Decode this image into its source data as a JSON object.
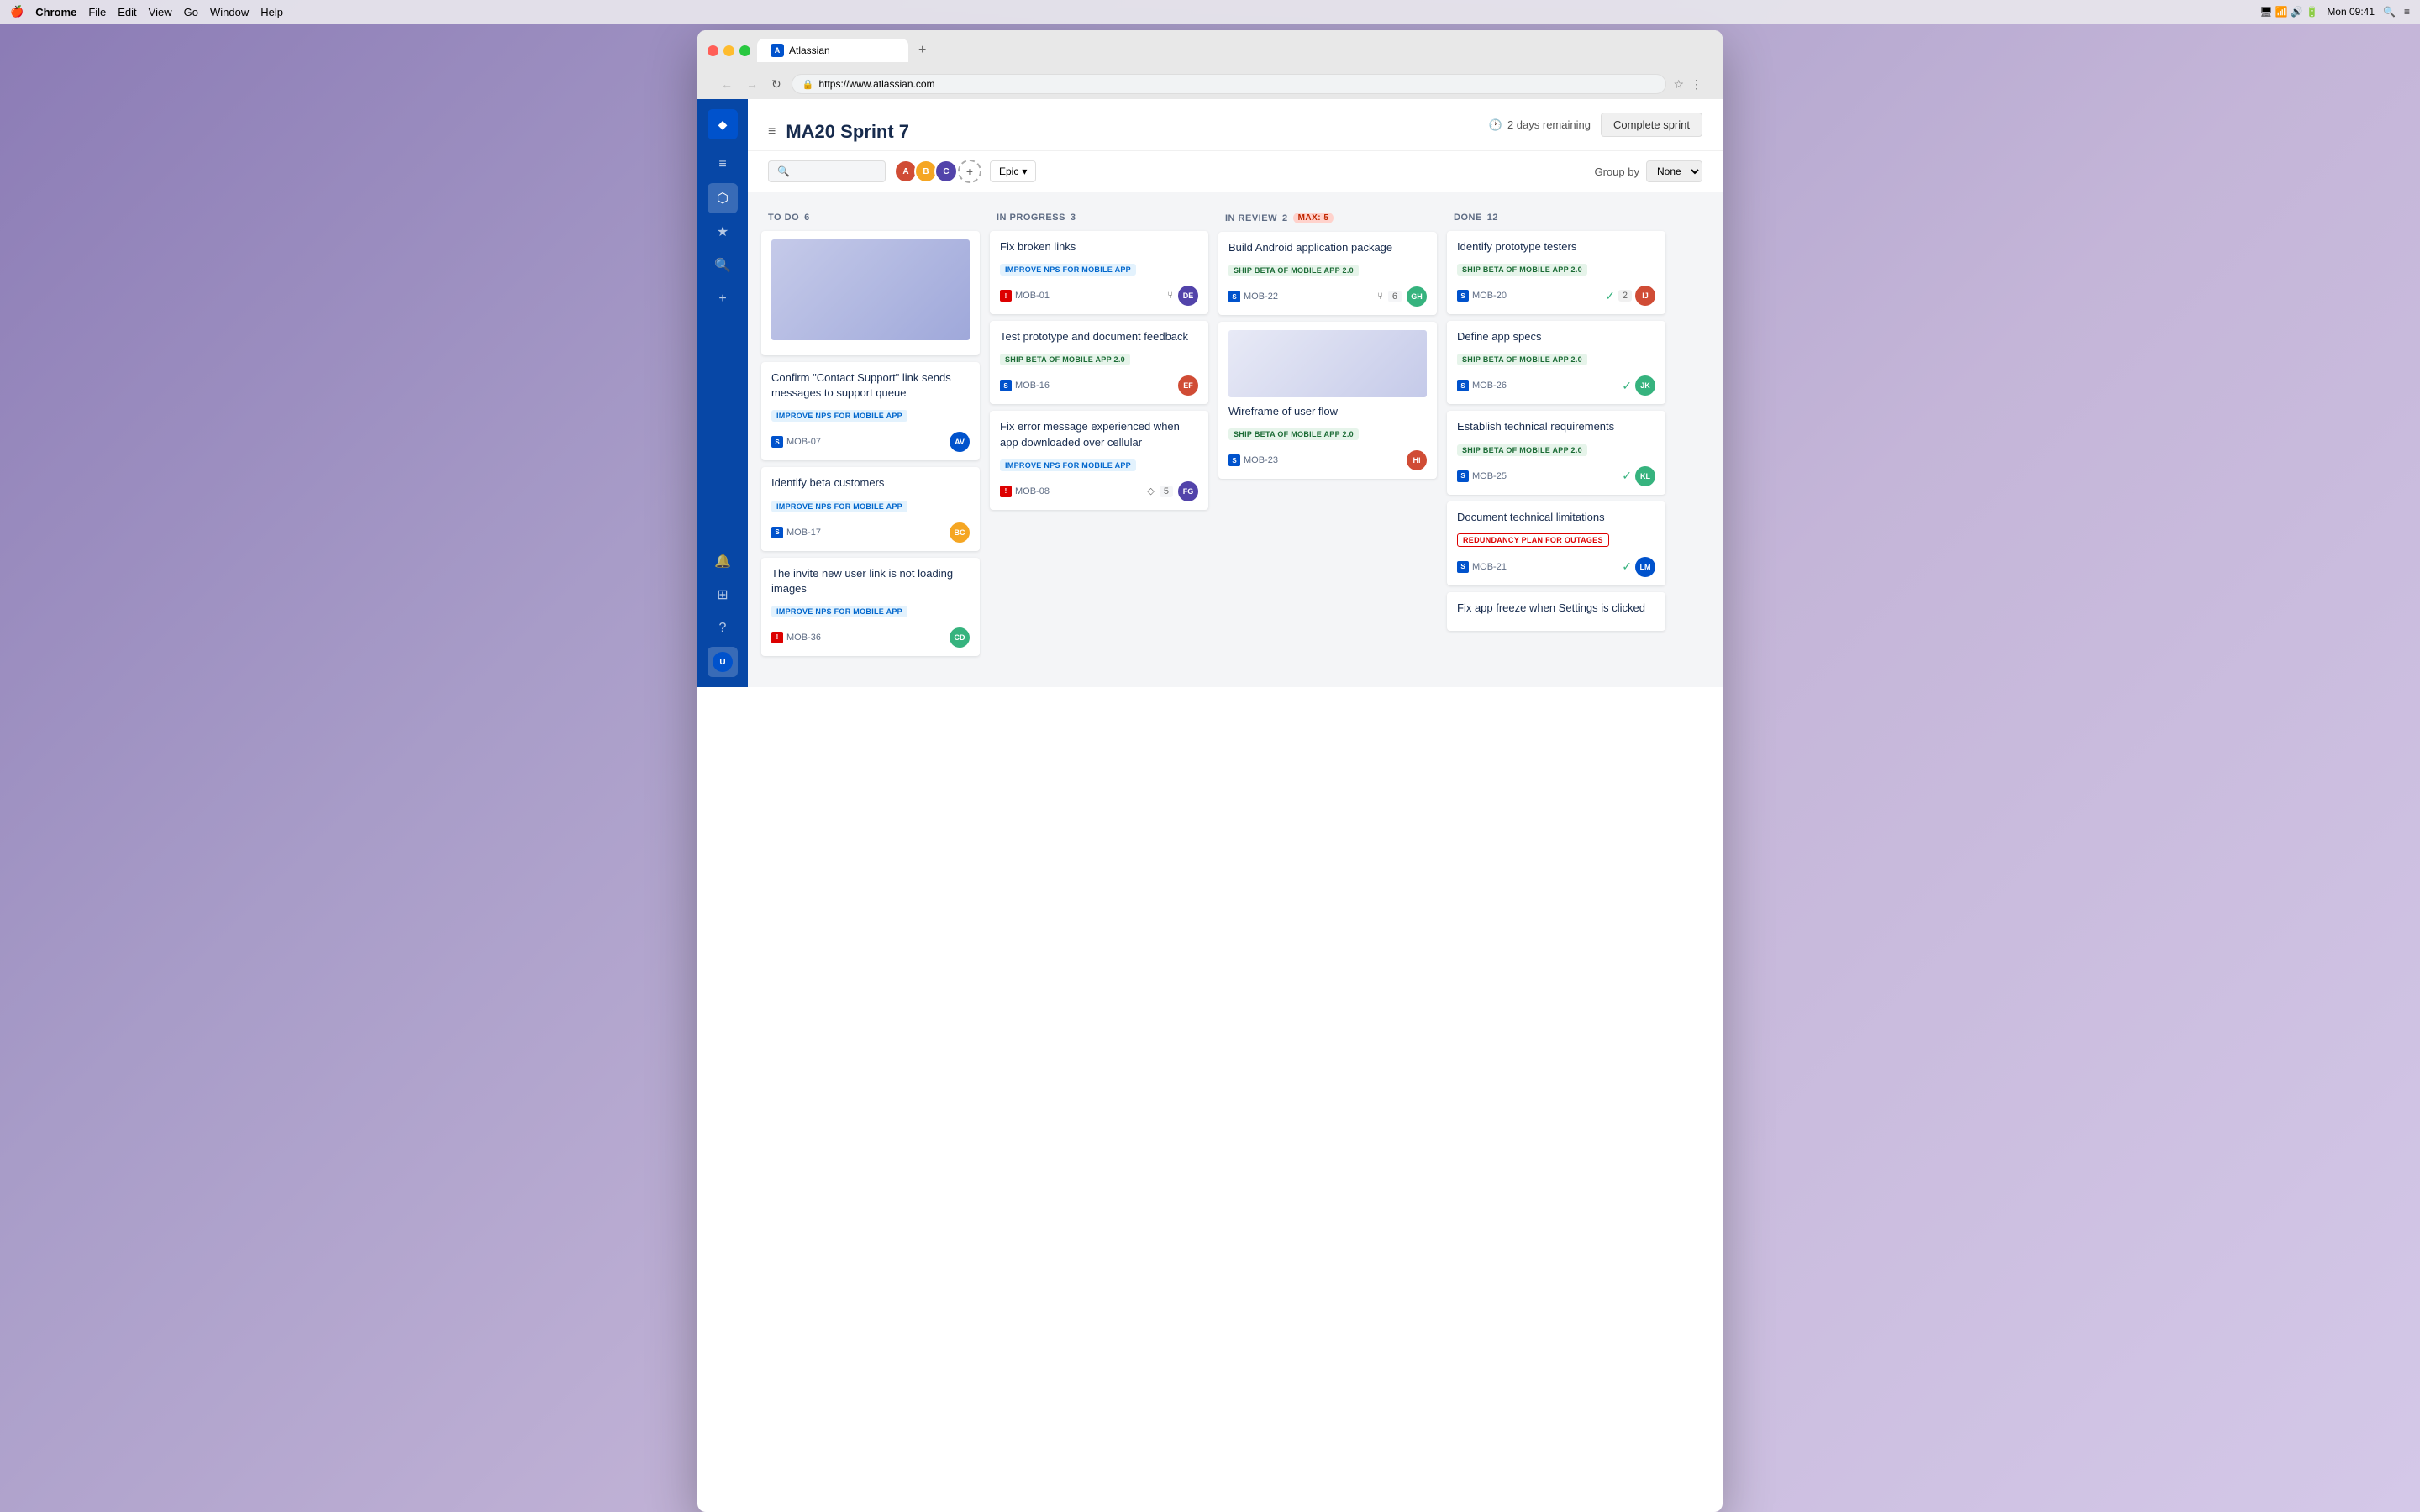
{
  "menubar": {
    "apple": "🍎",
    "chrome": "Chrome",
    "menus": [
      "File",
      "Edit",
      "View",
      "Go",
      "Window",
      "Help"
    ],
    "time": "Mon 09:41"
  },
  "browser": {
    "tab_title": "Atlassian",
    "url": "https://www.atlassian.com",
    "new_tab_label": "+",
    "nav": {
      "back": "←",
      "forward": "→",
      "reload": "↻"
    }
  },
  "sprint": {
    "title": "MA20 Sprint 7",
    "days_remaining": "2 days remaining",
    "complete_sprint_btn": "Complete sprint"
  },
  "filter": {
    "search_placeholder": "Search",
    "epic_label": "Epic",
    "group_by_label": "Group by",
    "group_by_value": "None"
  },
  "columns": [
    {
      "id": "todo",
      "label": "TO DO",
      "count": "6",
      "max": null,
      "cards": [
        {
          "id": "todo-img",
          "hasImage": true,
          "title": null,
          "epic": null,
          "cardId": null,
          "type": null,
          "avatar_color": null
        },
        {
          "id": "mob-07",
          "hasImage": false,
          "title": "Confirm \"Contact Support\" link sends messages to support queue",
          "epic": "IMPROVE NPS FOR MOBILE APP",
          "epicClass": "epic-blue",
          "cardId": "MOB-07",
          "type": "story",
          "avatar_color": "#0052cc",
          "avatar_initials": "AV"
        },
        {
          "id": "mob-17",
          "hasImage": false,
          "title": "Identify beta customers",
          "epic": "IMPROVE NPS FOR MOBILE APP",
          "epicClass": "epic-blue",
          "cardId": "MOB-17",
          "type": "story",
          "avatar_color": "#f5a623",
          "avatar_initials": "BC"
        },
        {
          "id": "mob-36",
          "hasImage": false,
          "title": "The invite new user link is not loading images",
          "epic": "IMPROVE NPS FOR MOBILE APP",
          "epicClass": "epic-blue",
          "cardId": "MOB-36",
          "type": "bug",
          "avatar_color": "#36b37e",
          "avatar_initials": "CD"
        }
      ]
    },
    {
      "id": "inprogress",
      "label": "IN PROGRESS",
      "count": "3",
      "max": null,
      "cards": [
        {
          "id": "mob-01",
          "title": "Fix broken links",
          "epic": "IMPROVE NPS FOR MOBILE APP",
          "epicClass": "epic-blue",
          "cardId": "MOB-01",
          "type": "bug",
          "avatar_color": "#5243aa",
          "avatar_initials": "DE",
          "story_points": null,
          "has_branch": true
        },
        {
          "id": "mob-16",
          "title": "Test prototype and document feedback",
          "epic": "SHIP BETA OF MOBILE APP 2.0",
          "epicClass": "epic-green",
          "cardId": "MOB-16",
          "type": "story",
          "avatar_color": "#d04c35",
          "avatar_initials": "EF",
          "story_points": null,
          "has_branch": false
        },
        {
          "id": "mob-08",
          "title": "Fix error message experienced when app downloaded over cellular",
          "epic": "IMPROVE NPS FOR MOBILE APP",
          "epicClass": "epic-blue",
          "cardId": "MOB-08",
          "type": "bug",
          "avatar_color": "#5243aa",
          "avatar_initials": "FG",
          "story_points": "5",
          "has_branch": true
        }
      ]
    },
    {
      "id": "inreview",
      "label": "IN REVIEW",
      "count": "2",
      "max": "MAX: 5",
      "cards": [
        {
          "id": "mob-22",
          "title": "Build Android application package",
          "epic": "SHIP BETA OF MOBILE APP 2.0",
          "epicClass": "epic-green",
          "cardId": "MOB-22",
          "type": "story",
          "avatar_color": "#36b37e",
          "avatar_initials": "GH",
          "story_points": "6",
          "has_branch": true
        },
        {
          "id": "mob-23",
          "title": "Wireframe of user flow",
          "epic": "SHIP BETA OF MOBILE APP 2.0",
          "epicClass": "epic-green",
          "cardId": "MOB-23",
          "type": "story",
          "avatar_color": "#d04c35",
          "avatar_initials": "HI",
          "story_points": null,
          "has_branch": false,
          "hasImage": true
        }
      ]
    },
    {
      "id": "done",
      "label": "DONE",
      "count": "12",
      "max": null,
      "cards": [
        {
          "id": "mob-20",
          "title": "Identify prototype testers",
          "epic": "SHIP BETA OF MOBILE APP 2.0",
          "epicClass": "epic-green",
          "cardId": "MOB-20",
          "type": "story",
          "avatar_color": "#d04c35",
          "avatar_initials": "IJ",
          "check_count": "2"
        },
        {
          "id": "mob-26",
          "title": "Define app specs",
          "epic": "SHIP BETA OF MOBILE APP 2.0",
          "epicClass": "epic-green",
          "cardId": "MOB-26",
          "type": "story",
          "avatar_color": "#36b37e",
          "avatar_initials": "JK",
          "check_count": null
        },
        {
          "id": "mob-25",
          "title": "Establish technical requirements",
          "epic": "SHIP BETA OF MOBILE APP 2.0",
          "epicClass": "epic-green",
          "cardId": "MOB-25",
          "type": "story",
          "avatar_color": "#36b37e",
          "avatar_initials": "KL",
          "check_count": null
        },
        {
          "id": "mob-21",
          "title": "Document technical limitations",
          "epic": "REDUNDANCY PLAN FOR OUTAGES",
          "epicClass": "epic-red-outline",
          "cardId": "MOB-21",
          "type": "story",
          "avatar_color": "#0052cc",
          "avatar_initials": "LM",
          "check_count": null
        },
        {
          "id": "mob-fix",
          "title": "Fix app freeze when Settings is clicked",
          "epic": null,
          "epicClass": null,
          "cardId": null,
          "type": null,
          "avatar_color": null,
          "avatar_initials": null,
          "check_count": null
        }
      ]
    }
  ],
  "avatars": [
    {
      "color": "#d04c35",
      "initials": "A"
    },
    {
      "color": "#f5a623",
      "initials": "B"
    },
    {
      "color": "#5243aa",
      "initials": "C"
    },
    {
      "color": "#aaa",
      "initials": "+"
    }
  ]
}
